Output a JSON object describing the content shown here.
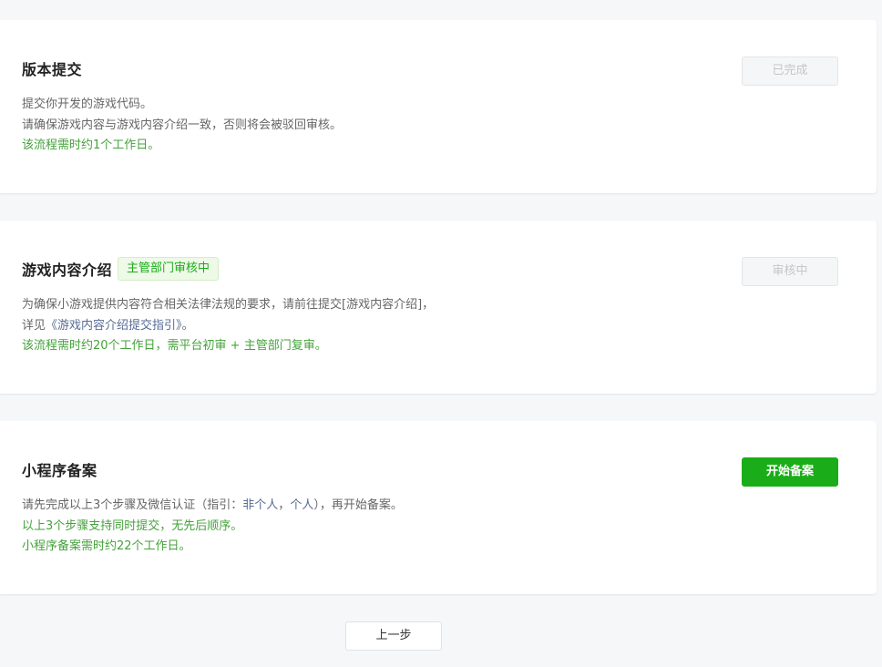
{
  "steps": [
    {
      "title": "版本提交",
      "button_label": "已完成",
      "lines": [
        "提交你开发的游戏代码。",
        "请确保游戏内容与游戏内容介绍一致，否则将会被驳回审核。"
      ],
      "green_lines": [
        "该流程需时约1个工作日。"
      ]
    },
    {
      "title": "游戏内容介绍",
      "status_tag": "主管部门审核中",
      "button_label": "审核中",
      "line_1": "为确保小游戏提供内容符合相关法律法规的要求，请前往提交[游戏内容介绍]，",
      "line_2_prefix": "详见",
      "line_2_link": "《游戏内容介绍提交指引》",
      "line_2_suffix": "。",
      "green_lines": [
        "该流程需时约20个工作日，需平台初审 + 主管部门复审。"
      ]
    },
    {
      "title": "小程序备案",
      "button_label": "开始备案",
      "line_1_prefix": "请先完成以上3个步骤及微信认证（指引：",
      "line_1_link_a": "非个人",
      "line_1_sep": "，",
      "line_1_link_b": "个人",
      "line_1_suffix": "），再开始备案。",
      "green_lines": [
        "以上3个步骤支持同时提交，无先后顺序。",
        "小程序备案需时约22个工作日。"
      ]
    }
  ],
  "footer": {
    "prev_label": "上一步"
  },
  "colors": {
    "accent_green": "#1aad19",
    "info_green": "#44a23b",
    "link_blue": "#576b95"
  }
}
